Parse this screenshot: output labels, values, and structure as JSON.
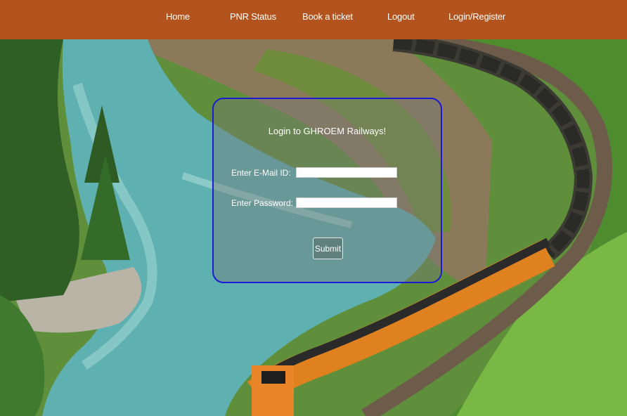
{
  "nav": {
    "items": [
      {
        "label": "Home"
      },
      {
        "label": "PNR Status"
      },
      {
        "label": "Book a ticket"
      },
      {
        "label": "Logout"
      },
      {
        "label": "Login/Register"
      }
    ]
  },
  "login": {
    "title": "Login to GHROEM Railways!",
    "email_label": "Enter E-Mail ID:",
    "email_value": "",
    "password_label": "Enter Password:",
    "password_value": "",
    "submit_label": "Submit"
  },
  "colors": {
    "navbar": "#b3541e",
    "panel_border": "#1b1bd6"
  }
}
